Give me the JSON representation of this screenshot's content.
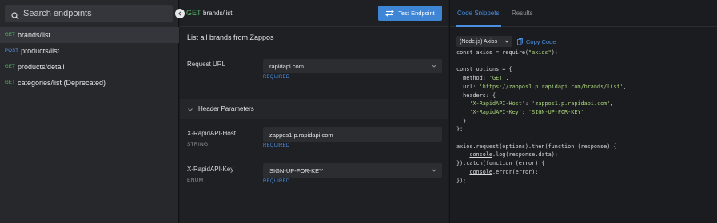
{
  "sidebar": {
    "search_placeholder": "Search endpoints",
    "endpoints": [
      {
        "method": "GET",
        "path": "brands/list",
        "active": true
      },
      {
        "method": "POST",
        "path": "products/list",
        "active": false
      },
      {
        "method": "GET",
        "path": "products/detail",
        "active": false
      },
      {
        "method": "GET",
        "path": "categories/list (Deprecated)",
        "active": false
      }
    ]
  },
  "endpoint": {
    "method": "GET",
    "path": "brands/list",
    "test_button_label": "Test Endpoint",
    "description": "List all brands from Zappos"
  },
  "request_url": {
    "label": "Request URL",
    "value": "rapidapi.com",
    "required": "REQUIRED"
  },
  "header_parameters": {
    "title": "Header Parameters",
    "params": [
      {
        "label": "X-RapidAPI-Host",
        "type": "STRING",
        "value": "zappos1.p.rapidapi.com",
        "required": "REQUIRED"
      },
      {
        "label": "X-RapidAPI-Key",
        "type": "ENUM",
        "value": "SIGN-UP-FOR-KEY",
        "required": "REQUIRED"
      }
    ]
  },
  "code_panel": {
    "tabs": [
      "Code Snippets",
      "Results"
    ],
    "active_tab": "Code Snippets",
    "language": "(Node.js) Axios",
    "copy_label": "Copy Code",
    "lines": [
      "const axios = require(\"axios\");",
      "",
      "const options = {",
      "  method: 'GET',",
      "  url: 'https://zappos1.p.rapidapi.com/brands/list',",
      "  headers: {",
      "    'X-RapidAPI-Host': 'zappos1.p.rapidapi.com',",
      "    'X-RapidAPI-Key': 'SIGN-UP-FOR-KEY'",
      "  }",
      "};",
      "",
      "axios.request(options).then(function (response) {",
      "    console.log(response.data);",
      "}).catch(function (error) {",
      "    console.error(error);",
      "});"
    ]
  },
  "colors": {
    "get": "#52b964",
    "post": "#5b9bf1",
    "accent": "#3f85d5",
    "string": "#a8d07a"
  }
}
